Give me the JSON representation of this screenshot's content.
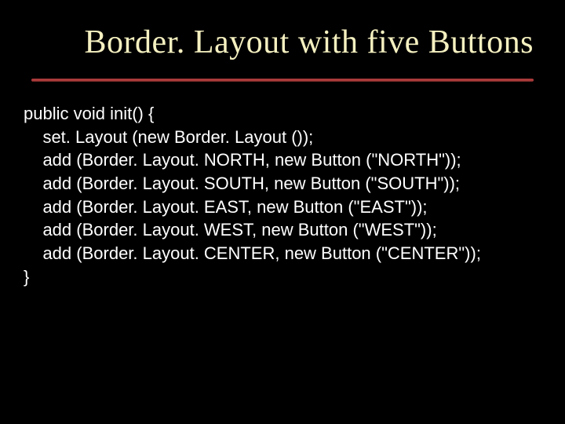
{
  "title": "Border. Layout with five Buttons",
  "code": "public void init() {\n    set. Layout (new Border. Layout ());\n    add (Border. Layout. NORTH, new Button (\"NORTH\"));\n    add (Border. Layout. SOUTH, new Button (\"SOUTH\"));\n    add (Border. Layout. EAST, new Button (\"EAST\"));\n    add (Border. Layout. WEST, new Button (\"WEST\"));\n    add (Border. Layout. CENTER, new Button (\"CENTER\"));\n}"
}
